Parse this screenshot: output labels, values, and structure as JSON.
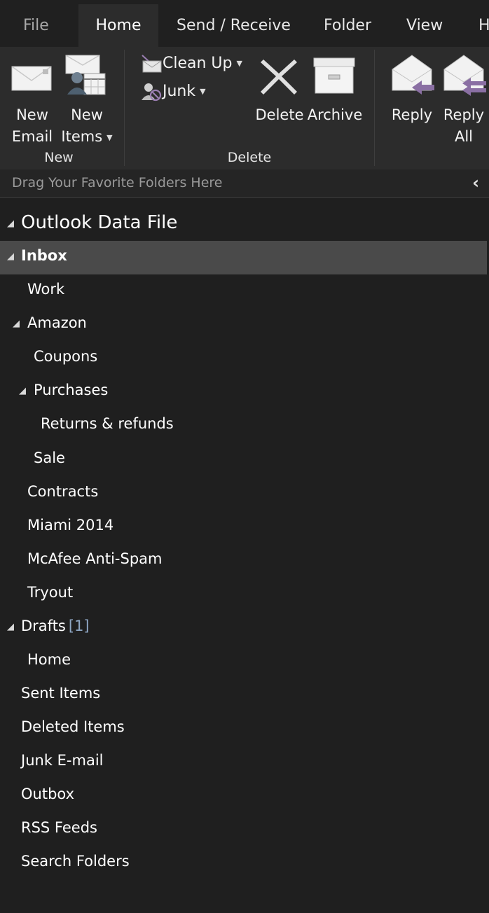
{
  "tabs": {
    "file": "File",
    "home": "Home",
    "send_receive": "Send / Receive",
    "folder": "Folder",
    "view": "View",
    "help": "H"
  },
  "ribbon": {
    "new_email": [
      "New",
      "Email"
    ],
    "new_items": [
      "New",
      "Items"
    ],
    "group_new": "New",
    "clean_up": "Clean Up",
    "junk": "Junk",
    "delete": "Delete",
    "archive": "Archive",
    "group_delete": "Delete",
    "reply": "Reply",
    "reply_all": [
      "Reply",
      "All"
    ]
  },
  "favorites": {
    "placeholder": "Drag Your Favorite Folders Here"
  },
  "tree": {
    "root": "Outlook Data File",
    "inbox": "Inbox",
    "work": "Work",
    "amazon": "Amazon",
    "coupons": "Coupons",
    "purchases": "Purchases",
    "returns": "Returns & refunds",
    "sale": "Sale",
    "contracts": "Contracts",
    "miami": "Miami 2014",
    "mcafee": "McAfee Anti-Spam",
    "tryout": "Tryout",
    "drafts": "Drafts",
    "drafts_count": "[1]",
    "home": "Home",
    "sent": "Sent Items",
    "deleted": "Deleted Items",
    "junk": "Junk E-mail",
    "outbox": "Outbox",
    "rss": "RSS Feeds",
    "search": "Search Folders"
  },
  "icons": {
    "expanded": "expanded-triangle-icon",
    "collapse_pane": "chevron-left-icon"
  },
  "colors": {
    "background": "#1f1f1f",
    "ribbon": "#2c2c2c",
    "selected_row": "#4a4a4a",
    "unread_count": "#8fa7c4"
  }
}
